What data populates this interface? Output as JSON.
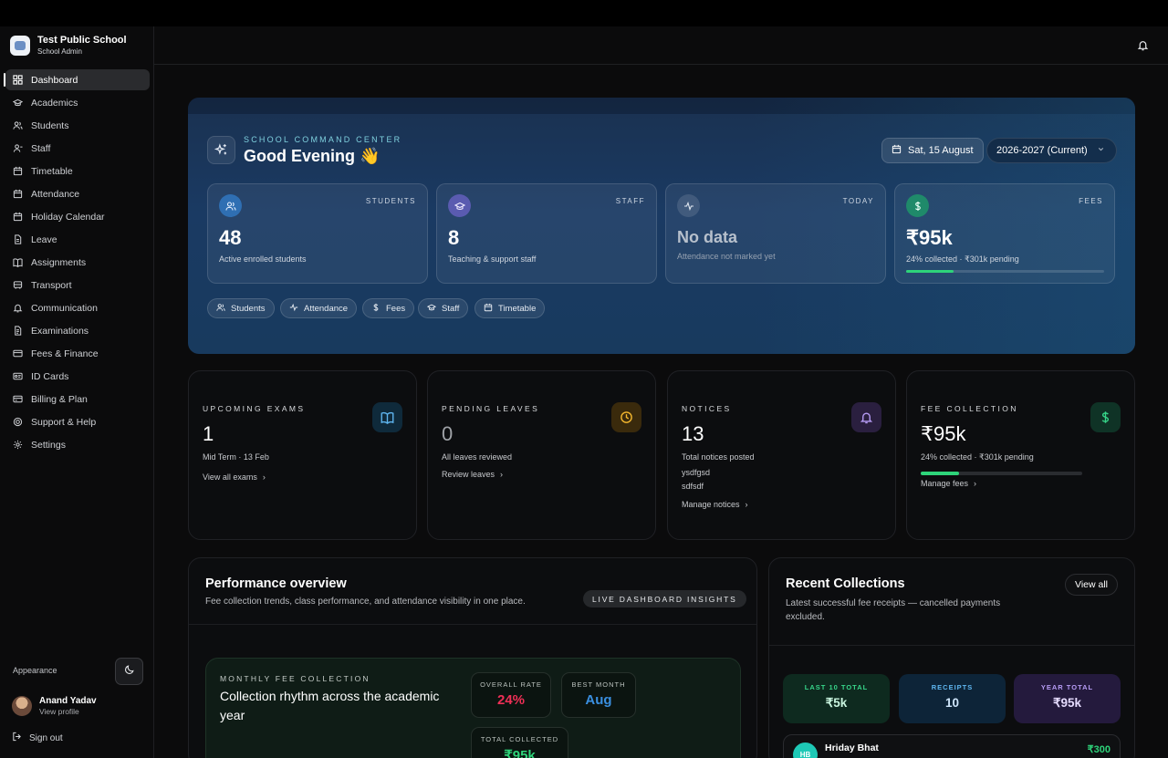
{
  "colors": {
    "accent_green": "#2ed47a",
    "hero_bg": "#1a3a63",
    "page_bg": "#0b0b0c"
  },
  "brand": {
    "name": "Test Public School",
    "role": "School Admin"
  },
  "sidebar": {
    "items": [
      {
        "label": "Dashboard",
        "icon": "dashboard-icon",
        "active": true
      },
      {
        "label": "Academics",
        "icon": "graduation-cap-icon"
      },
      {
        "label": "Students",
        "icon": "users-icon"
      },
      {
        "label": "Staff",
        "icon": "user-icon"
      },
      {
        "label": "Timetable",
        "icon": "calendar-icon"
      },
      {
        "label": "Attendance",
        "icon": "calendar-check-icon"
      },
      {
        "label": "Holiday Calendar",
        "icon": "calendar-icon"
      },
      {
        "label": "Leave",
        "icon": "file-icon"
      },
      {
        "label": "Assignments",
        "icon": "book-icon"
      },
      {
        "label": "Transport",
        "icon": "bus-icon"
      },
      {
        "label": "Communication",
        "icon": "bell-icon"
      },
      {
        "label": "Examinations",
        "icon": "file-text-icon"
      },
      {
        "label": "Fees & Finance",
        "icon": "wallet-icon"
      },
      {
        "label": "ID Cards",
        "icon": "id-card-icon"
      },
      {
        "label": "Billing & Plan",
        "icon": "credit-card-icon"
      },
      {
        "label": "Support & Help",
        "icon": "lifebuoy-icon"
      },
      {
        "label": "Settings",
        "icon": "gear-icon"
      }
    ],
    "appearance_label": "Appearance",
    "user": {
      "name": "Anand Yadav",
      "sub": "View profile"
    },
    "signout_label": "Sign out"
  },
  "hero": {
    "kicker": "SCHOOL COMMAND CENTER",
    "title": "Good Evening 👋",
    "date": "Sat, 15 August",
    "year": "2026-2027 (Current)",
    "stats": [
      {
        "label": "STUDENTS",
        "value": "48",
        "sub": "Active enrolled students",
        "icon": "users-icon"
      },
      {
        "label": "STAFF",
        "value": "8",
        "sub": "Teaching & support staff",
        "icon": "graduation-cap-icon"
      },
      {
        "label": "TODAY",
        "value": "No data",
        "sub": "Attendance not marked yet",
        "icon": "activity-icon"
      },
      {
        "label": "FEES",
        "value": "₹95k",
        "sub": "24% collected · ₹301k pending",
        "icon": "dollar-icon",
        "progress": 0.24
      }
    ],
    "quick_links": [
      "Students",
      "Attendance",
      "Fees",
      "Staff",
      "Timetable"
    ]
  },
  "cards": [
    {
      "label": "UPCOMING EXAMS",
      "value": "1",
      "sub": "Mid Term · 13 Feb",
      "link": "View all exams",
      "icon": "book-open-icon"
    },
    {
      "label": "PENDING LEAVES",
      "value": "0",
      "sub": "All leaves reviewed",
      "link": "Review leaves",
      "icon": "clock-icon"
    },
    {
      "label": "NOTICES",
      "value": "13",
      "sub": "Total notices posted",
      "notes": [
        "ysdfgsd",
        "sdfsdf"
      ],
      "link": "Manage notices",
      "icon": "bell-icon"
    },
    {
      "label": "FEE COLLECTION",
      "value": "₹95k",
      "sub": "24% collected · ₹301k pending",
      "link": "Manage fees",
      "icon": "dollar-icon",
      "progress": 0.24
    }
  ],
  "performance": {
    "title": "Performance overview",
    "sub": "Fee collection trends, class performance, and attendance visibility in one place.",
    "badge": "LIVE DASHBOARD INSIGHTS",
    "monthly": {
      "kicker": "MONTHLY FEE COLLECTION",
      "title": "Collection rhythm across the academic year",
      "overall_label": "OVERALL RATE",
      "overall_value": "24%",
      "best_label": "BEST MONTH",
      "best_value": "Aug",
      "total_label": "TOTAL COLLECTED",
      "total_value": "₹95k"
    }
  },
  "recent": {
    "title": "Recent Collections",
    "sub": "Latest successful fee receipts — cancelled payments excluded.",
    "view_all": "View all",
    "totals": [
      {
        "label": "LAST 10 TOTAL",
        "value": "₹5k"
      },
      {
        "label": "RECEIPTS",
        "value": "10"
      },
      {
        "label": "YEAR TOTAL",
        "value": "₹95k"
      }
    ],
    "receipts": [
      {
        "initials": "HB",
        "name": "Hriday Bhat",
        "amount": "₹300"
      }
    ]
  }
}
